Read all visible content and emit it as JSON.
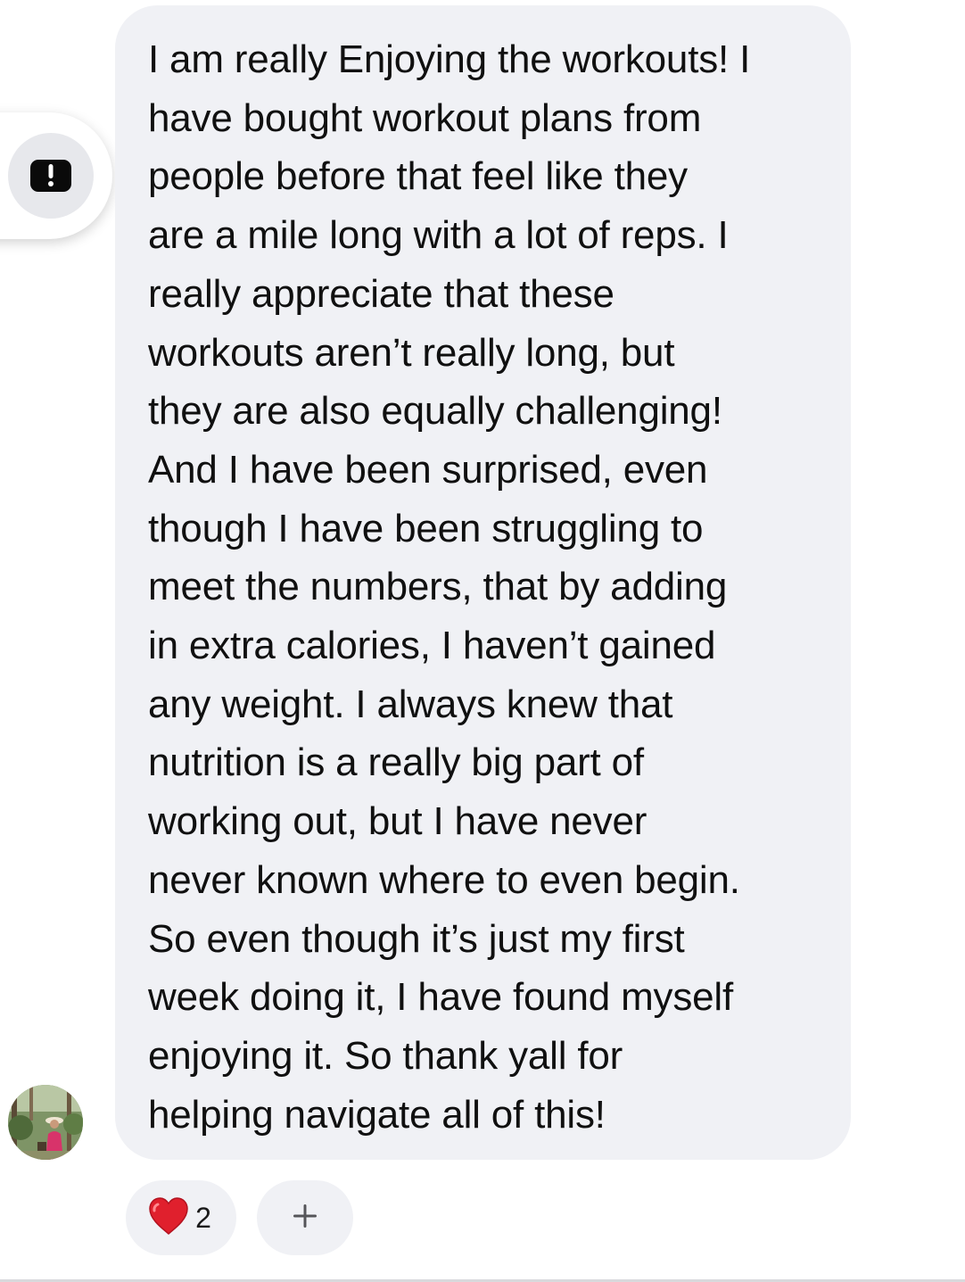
{
  "side_action": {
    "icon": "alert-icon",
    "glyph": "!"
  },
  "message": {
    "text": "I am really Enjoying the workouts! I\nhave bought workout plans from\npeople before that feel like they\nare a mile long with a lot of reps. I\nreally appreciate that these\nworkouts aren’t really long, but\nthey are also equally challenging!\nAnd I have been surprised, even\nthough I have been struggling to\nmeet the numbers, that by adding\nin extra calories, I haven’t gained\nany weight. I always knew that\nnutrition is a really big part of\nworking out, but I have never\nnever known where to even begin.\nSo even though it’s just my first\nweek doing it, I have found myself\nenjoying it. So thank yall for\nhelping navigate all of this!"
  },
  "reactions": [
    {
      "icon": "heart-icon",
      "count": "2"
    },
    {
      "icon": "plus-icon",
      "glyph": "+"
    }
  ],
  "colors": {
    "bubble": "#f0f1f5",
    "text": "#101010",
    "heart": "#e0202d",
    "icon_dark": "#0a0a0a"
  }
}
